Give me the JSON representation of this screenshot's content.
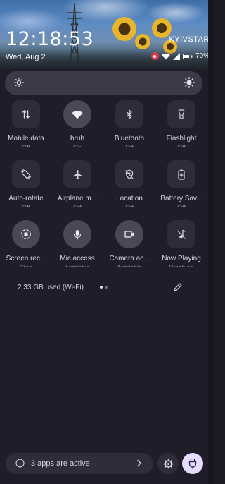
{
  "status": {
    "time": "12:18:53",
    "date": "Wed, Aug 2",
    "carrier": "KYIVSTAR",
    "battery": "70%",
    "icons": [
      "screen-record-icon",
      "wifi-icon",
      "signal-icon",
      "battery-icon"
    ]
  },
  "brightness": {
    "low_icon": "sun-low-icon",
    "high_icon": "sun-high-icon"
  },
  "tiles": [
    {
      "label": "Mobile data",
      "state": "Off",
      "icon": "mobile-data-icon",
      "active": false
    },
    {
      "label": "bruh",
      "state": "On",
      "icon": "wifi-icon",
      "active": true
    },
    {
      "label": "Bluetooth",
      "state": "Off",
      "icon": "bluetooth-icon",
      "active": false
    },
    {
      "label": "Flashlight",
      "state": "Off",
      "icon": "flashlight-icon",
      "active": false
    },
    {
      "label": "Auto-rotate",
      "state": "Off",
      "icon": "auto-rotate-icon",
      "active": false
    },
    {
      "label": "Airplane m...",
      "state": "Off",
      "icon": "airplane-icon",
      "active": false
    },
    {
      "label": "Location",
      "state": "Off",
      "icon": "location-off-icon",
      "active": false
    },
    {
      "label": "Battery Sav...",
      "state": "Off",
      "icon": "battery-saver-icon",
      "active": false
    },
    {
      "label": "Screen rec...",
      "state": "Stop",
      "icon": "screen-record-icon",
      "active": true
    },
    {
      "label": "Mic access",
      "state": "Available",
      "icon": "mic-icon",
      "active": true
    },
    {
      "label": "Camera ac...",
      "state": "Available",
      "icon": "camera-icon",
      "active": true
    },
    {
      "label": "Now Playing",
      "state": "Disabled",
      "icon": "now-playing-icon",
      "active": false
    }
  ],
  "storage": {
    "text": "2.33 GB used (Wi-Fi)",
    "page_count": 2,
    "current_page": 1
  },
  "footer": {
    "active_apps": "3 apps are active"
  },
  "colors": {
    "background": "#201d2b",
    "tile_inactive": "#2e2b3a",
    "tile_active": "#4a4757",
    "power_accent": "#e6dcff"
  }
}
